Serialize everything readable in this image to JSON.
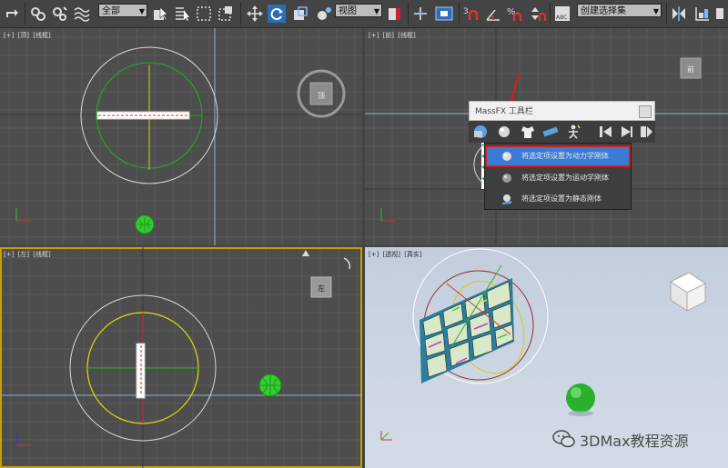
{
  "toolbar": {
    "selection_filter": "全部",
    "reference_coord": "视图",
    "named_selection": "创建选择集",
    "icons": [
      "redo-icon",
      "link-icon",
      "unlink-icon",
      "bind-spacewarp-icon",
      "select-object-icon",
      "select-by-name-icon",
      "rect-region-icon",
      "window-crossing-icon",
      "move-icon",
      "rotate-icon",
      "scale-icon",
      "pivot-icon",
      "mirror-icon",
      "align-icon",
      "snap-3d-icon",
      "angle-snap-icon",
      "percent-snap-icon",
      "spinner-snap-icon",
      "edit-named-sel-icon"
    ]
  },
  "viewports": {
    "top": {
      "labels": [
        "[+]",
        "[顶]",
        "[线框]"
      ]
    },
    "front": {
      "labels": [
        "[+]",
        "[前]",
        "[线框]"
      ]
    },
    "left": {
      "labels": [
        "[+]",
        "[左]",
        "[线框]"
      ]
    },
    "perspective": {
      "labels": [
        "[+]",
        "[透视]",
        "[真实]"
      ]
    }
  },
  "viewcube": {
    "top": "顶",
    "front": "前",
    "left": "左"
  },
  "massfx": {
    "title": "MassFX 工具栏",
    "menu": [
      {
        "label": "将选定项设置为动力学刚体",
        "icon": "dynamic-rigid-body-icon",
        "highlighted": true
      },
      {
        "label": "将选定项设置为运动学刚体",
        "icon": "kinematic-rigid-body-icon",
        "highlighted": false
      },
      {
        "label": "将选定项设置为静态刚体",
        "icon": "static-rigid-body-icon",
        "highlighted": false
      }
    ]
  },
  "watermark": "3DMax教程资源",
  "colors": {
    "ui_bg": "#444444",
    "viewport_bg": "#4d4d4d",
    "grid": "#5e5e5e",
    "perspective_bg": "#c9d3e0",
    "active_border": "#c8a000",
    "highlight": "#3a7bd5",
    "callout_red": "#e01818"
  }
}
